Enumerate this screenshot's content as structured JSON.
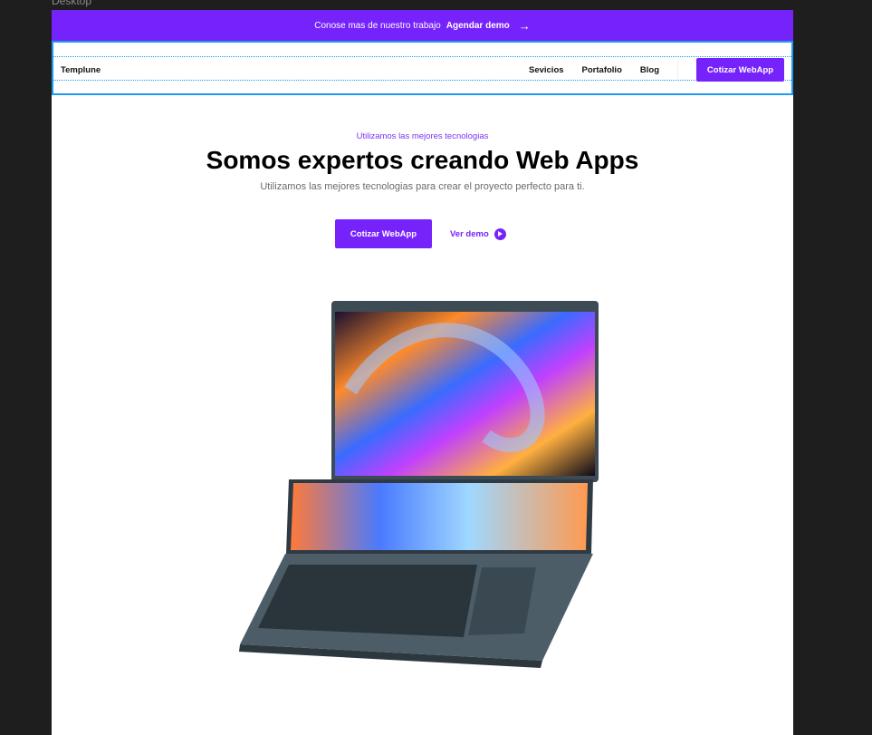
{
  "canvas": {
    "frame_label": "Desktop"
  },
  "banner": {
    "text": "Conose mas de nuestro trabajo",
    "link": "Agendar demo",
    "arrow": "→"
  },
  "nav": {
    "logo": "Templune",
    "links": [
      "Sevicios",
      "Portafolio",
      "Blog"
    ],
    "cta": "Cotizar WebApp"
  },
  "hero": {
    "eyebrow": "Utilizamos las mejores tecnologias",
    "title": "Somos expertos creando Web Apps",
    "subtitle": "Utilizamos las mejores tecnologias para crear el proyecto perfecto para ti.",
    "primary_cta": "Cotizar WebApp",
    "secondary_cta": "Ver demo"
  },
  "colors": {
    "brand": "#7622fb",
    "selection": "#1e9bf0"
  }
}
